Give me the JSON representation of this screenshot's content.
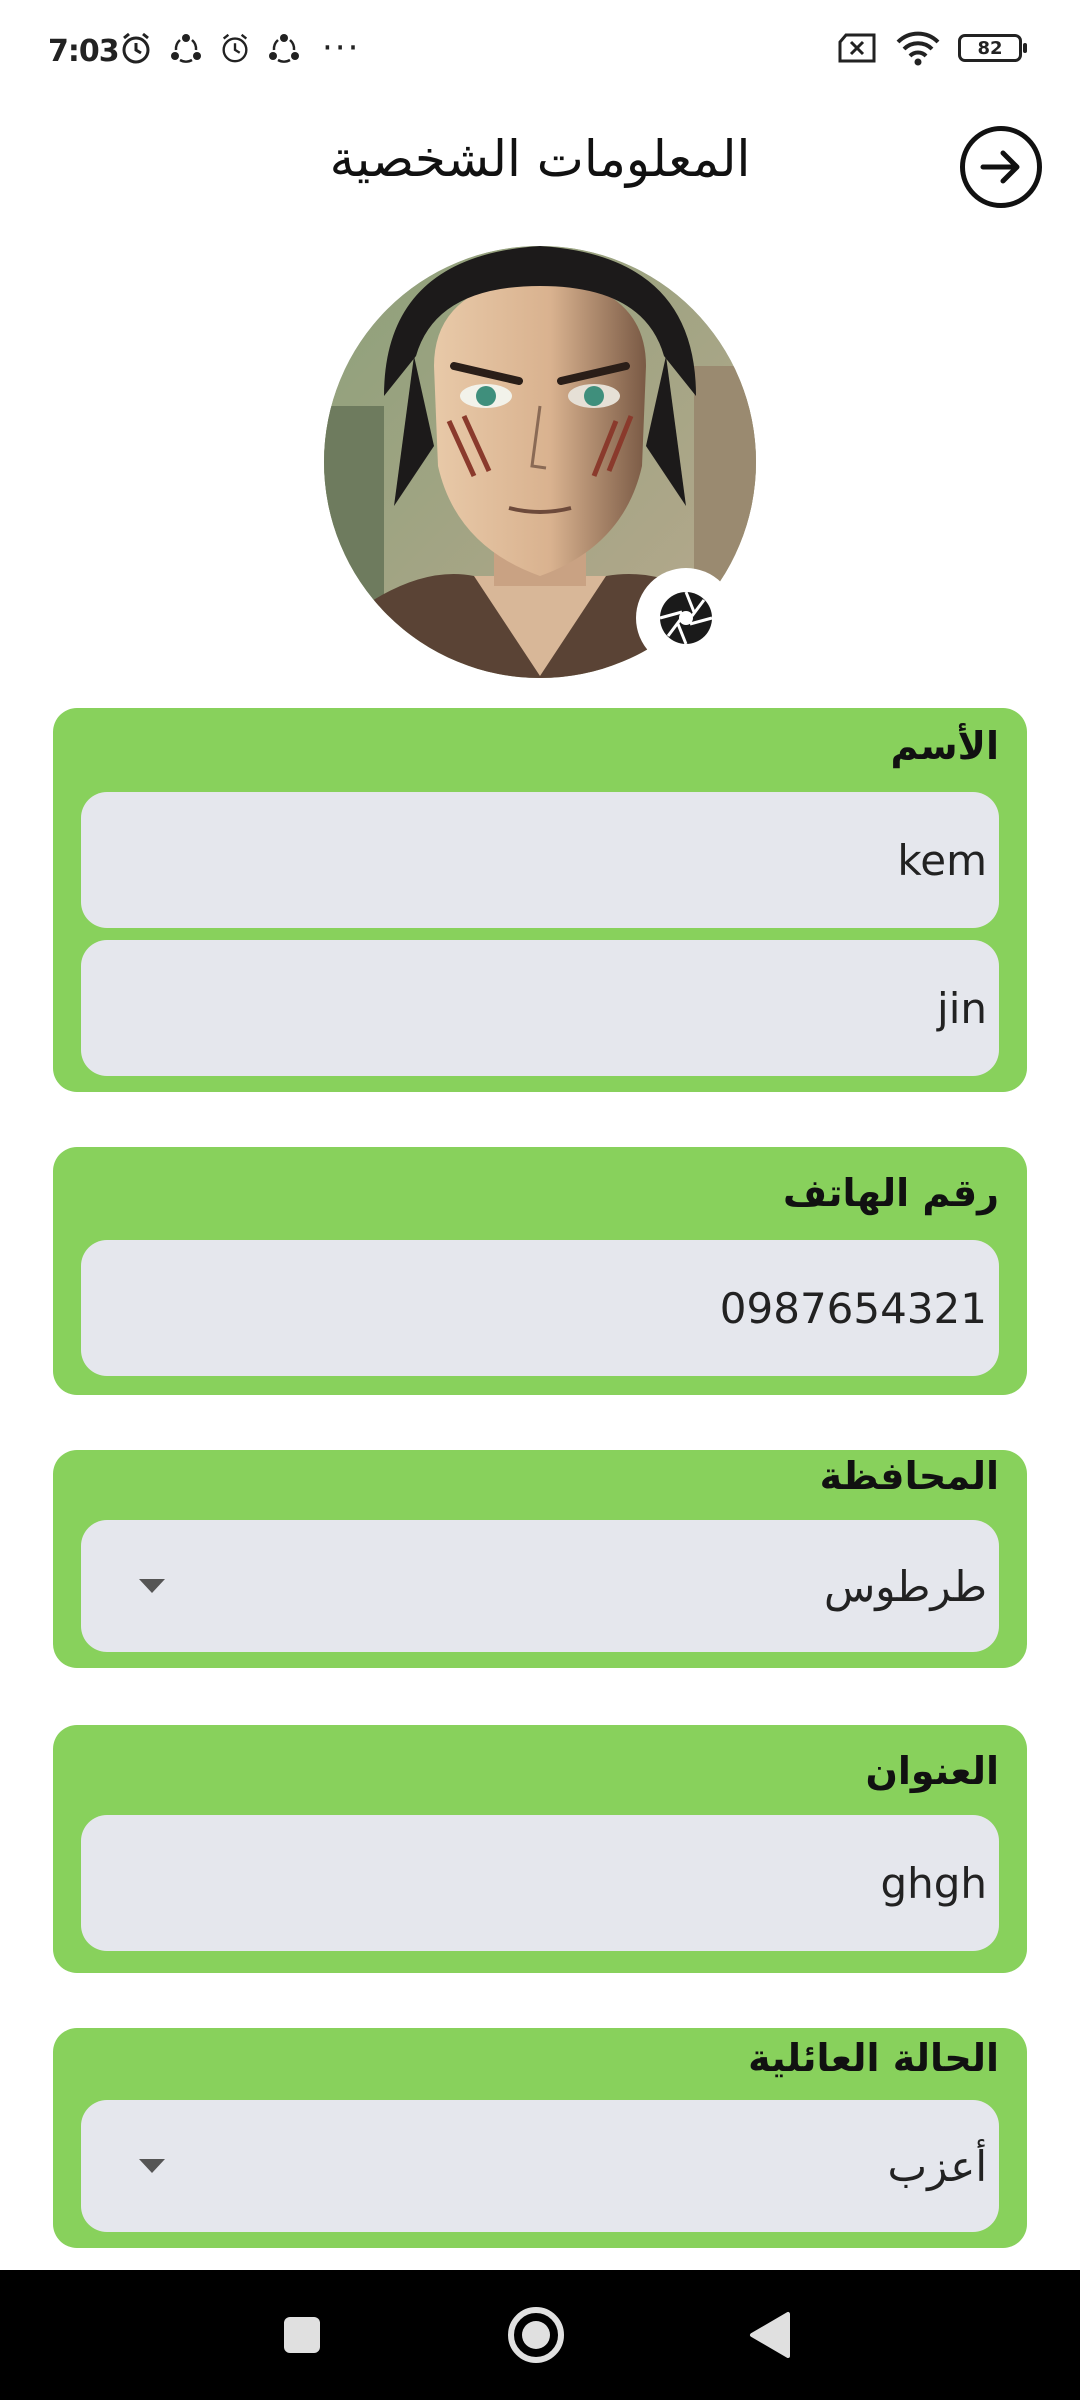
{
  "status_bar": {
    "time": "7:03",
    "battery": "82"
  },
  "header": {
    "title": "المعلومات الشخصية"
  },
  "form": {
    "name": {
      "label": "الأسم",
      "first_name": "kem",
      "last_name": "jin"
    },
    "phone": {
      "label": "رقم الهاتف",
      "value": "0987654321"
    },
    "governorate": {
      "label": "المحافظة",
      "value": "طرطوس"
    },
    "address": {
      "label": "العنوان",
      "value": "ghgh"
    },
    "marital_status": {
      "label": "الحالة العائلية",
      "value": "أعزب"
    }
  },
  "colors": {
    "card_background": "#88d15c",
    "field_background": "#e5e7ed",
    "nav_bar": "#000000"
  },
  "icons": {
    "back": "arrow-right-icon",
    "camera": "camera-aperture-icon",
    "nav_recents": "square-icon",
    "nav_home": "circle-icon",
    "nav_back": "triangle-back-icon"
  }
}
